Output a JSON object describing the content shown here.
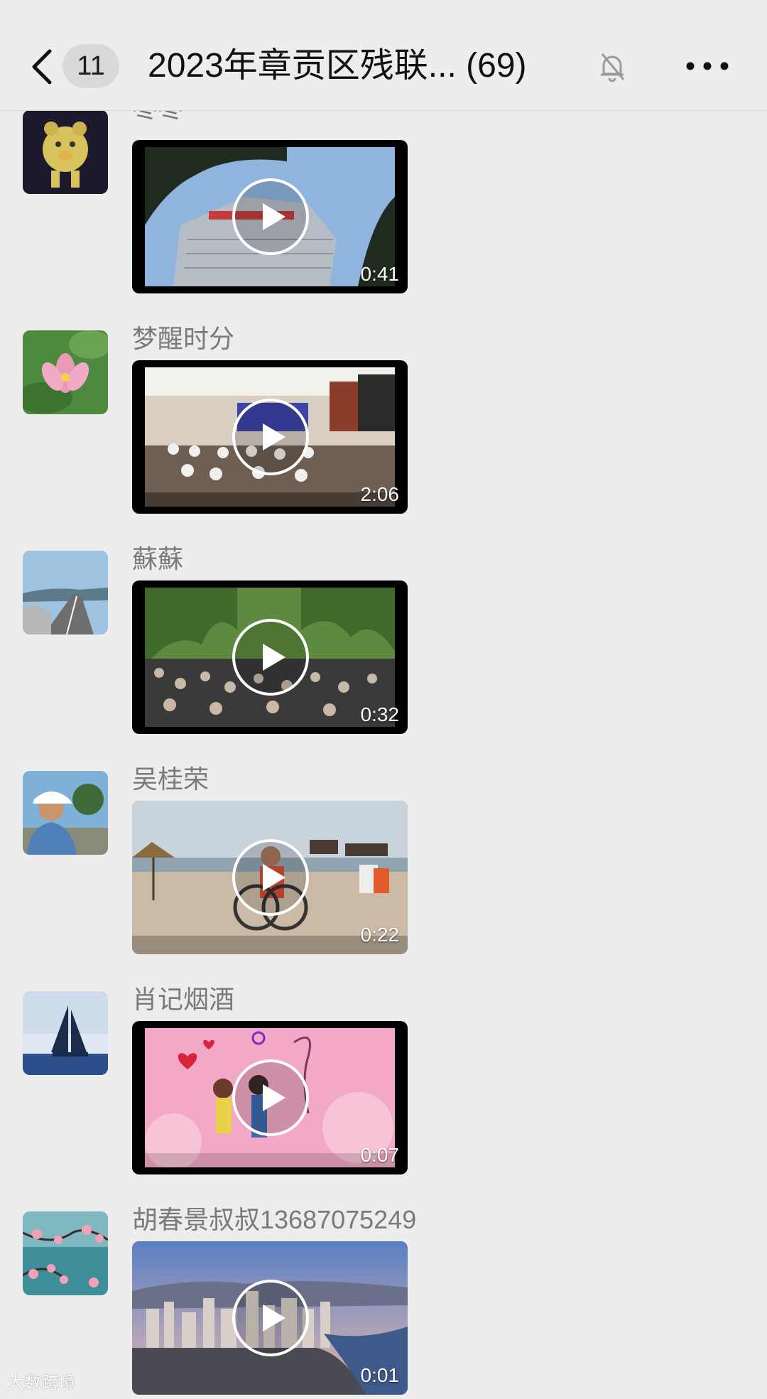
{
  "header": {
    "unread_count": "11",
    "title": "2023年章贡区残联... (69)"
  },
  "messages": [
    {
      "sender": "枣枣",
      "duration": "0:41",
      "avatar": "knitted-pig-avatar",
      "thumb": "building-video"
    },
    {
      "sender": "梦醒时分",
      "duration": "2:06",
      "avatar": "lotus-avatar",
      "thumb": "meeting-room-video"
    },
    {
      "sender": "蘇蘇",
      "duration": "0:32",
      "avatar": "road-avatar",
      "thumb": "crowd-trees-video"
    },
    {
      "sender": "吴桂荣",
      "duration": "0:22",
      "avatar": "man-cap-avatar",
      "thumb": "beach-wheelchair-video"
    },
    {
      "sender": "肖记烟酒",
      "duration": "0:07",
      "avatar": "sailboat-avatar",
      "thumb": "cartoon-couple-video"
    },
    {
      "sender": "胡春景叔叔13687075249",
      "duration": "0:01",
      "avatar": "plum-blossom-avatar",
      "thumb": "city-river-video"
    }
  ],
  "watermark": "大数跨境"
}
